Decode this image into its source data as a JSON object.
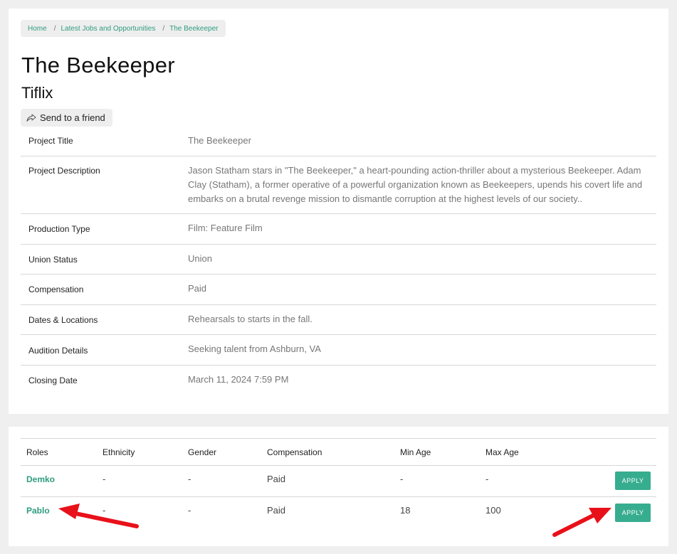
{
  "breadcrumb": {
    "items": [
      "Home",
      "Latest Jobs and Opportunities",
      "The Beekeeper"
    ],
    "separator": "/"
  },
  "header": {
    "title": "The Beekeeper",
    "company": "Tiflix",
    "send_label": "Send to a friend"
  },
  "details": [
    {
      "label": "Project Title",
      "value": "The Beekeeper"
    },
    {
      "label": "Project Description",
      "value": "Jason Statham stars in \"The Beekeeper,\" a heart-pounding action-thriller about a mysterious Beekeeper. Adam Clay (Statham), a former operative of a powerful organization known as Beekeepers, upends his covert life and embarks on a brutal revenge mission to dismantle corruption at the highest levels of our society.."
    },
    {
      "label": "Production Type",
      "value": "Film: Feature Film"
    },
    {
      "label": "Union Status",
      "value": "Union"
    },
    {
      "label": "Compensation",
      "value": "Paid"
    },
    {
      "label": "Dates & Locations",
      "value": "Rehearsals to starts in the fall."
    },
    {
      "label": "Audition Details",
      "value": "Seeking talent from Ashburn, VA"
    },
    {
      "label": "Closing Date",
      "value": "March 11, 2024 7:59 PM"
    }
  ],
  "roles": {
    "headers": [
      "Roles",
      "Ethnicity",
      "Gender",
      "Compensation",
      "Min Age",
      "Max Age"
    ],
    "rows": [
      {
        "role": "Demko",
        "ethnicity": "-",
        "gender": "-",
        "compensation": "Paid",
        "min_age": "-",
        "max_age": "-",
        "apply_label": "APPLY"
      },
      {
        "role": "Pablo",
        "ethnicity": "-",
        "gender": "-",
        "compensation": "Paid",
        "min_age": "18",
        "max_age": "100",
        "apply_label": "APPLY"
      }
    ]
  },
  "colors": {
    "accent": "#37ad90",
    "link": "#2f9c7f",
    "annotation_arrow": "#e8111a"
  },
  "icons": {
    "send": "share-arrow-icon",
    "annotation": "red-arrow-icon"
  }
}
